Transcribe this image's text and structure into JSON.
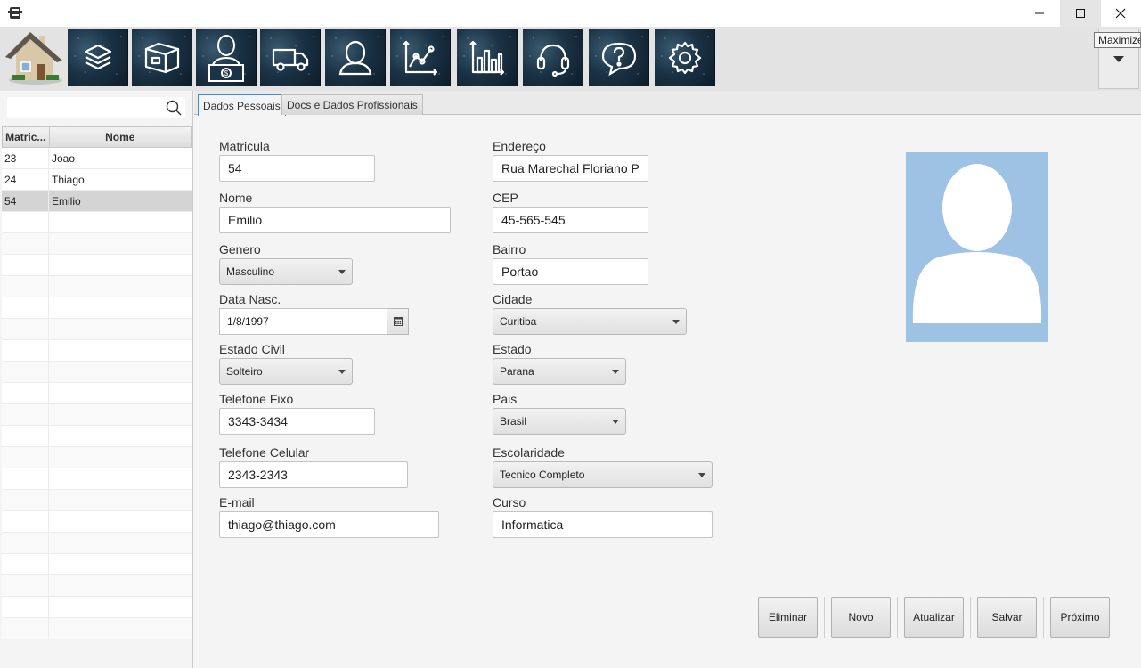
{
  "window": {
    "tooltip": "Maximize"
  },
  "toolbar": {
    "buttons": [
      "home",
      "layers",
      "box",
      "cashier",
      "truck",
      "user",
      "line-chart",
      "bar-chart",
      "headset",
      "help",
      "settings"
    ]
  },
  "search": {
    "value": "",
    "placeholder": ""
  },
  "table": {
    "headers": [
      "Matric...",
      "Nome"
    ],
    "rows": [
      {
        "id": "23",
        "name": "Joao"
      },
      {
        "id": "24",
        "name": "Thiago"
      },
      {
        "id": "54",
        "name": "Emilio"
      }
    ],
    "selected": "54"
  },
  "tabs": [
    "Dados Pessoais",
    "Docs e Dados Profissionais"
  ],
  "form": {
    "matricula_label": "Matricula",
    "matricula": "54",
    "nome_label": "Nome",
    "nome": "Emilio",
    "genero_label": "Genero",
    "genero": "Masculino",
    "data_nasc_label": "Data Nasc.",
    "data_nasc": "1/8/1997",
    "estado_civil_label": "Estado Civil",
    "estado_civil": "Solteiro",
    "telefone_fixo_label": "Telefone Fixo",
    "telefone_fixo": "3343-3434",
    "telefone_celular_label": "Telefone Celular",
    "telefone_celular": "2343-2343",
    "email_label": "E-mail",
    "email": "thiago@thiago.com",
    "endereco_label": "Endereço",
    "endereco": "Rua Marechal Floriano P",
    "cep_label": "CEP",
    "cep": "45-565-545",
    "bairro_label": "Bairro",
    "bairro": "Portao",
    "cidade_label": "Cidade",
    "cidade": "Curitiba",
    "estado_label": "Estado",
    "estado": "Parana",
    "pais_label": "Pais",
    "pais": "Brasil",
    "escolaridade_label": "Escolaridade",
    "escolaridade": "Tecnico Completo",
    "curso_label": "Curso",
    "curso": "Informatica"
  },
  "actions": {
    "eliminar": "Eliminar",
    "novo": "Novo",
    "atualizar": "Atualizar",
    "salvar": "Salvar",
    "proximo": "Próximo"
  },
  "colors": {
    "avatar_bg": "#9dc2e4",
    "toolbar_button_bg": "#1b3346",
    "active_tab_border": "#3c8fd6"
  }
}
